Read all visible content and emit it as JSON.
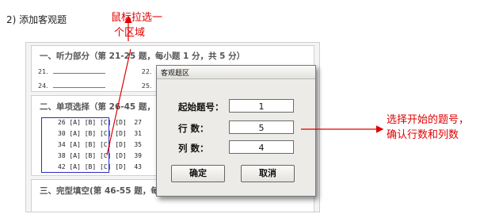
{
  "step_label": "2) 添加客观题",
  "top_note": [
    "鼠标拉选一",
    "个区域"
  ],
  "right_note": [
    "选择开始的题号，",
    "确认行数和列数"
  ],
  "document": {
    "section1_heading": "一、听力部分（第 21-25 题，每小题 1 分，共 5 分）",
    "section1_lines": [
      {
        "num": "21.",
        "next": "22."
      },
      {
        "num": "24.",
        "next": "25."
      }
    ],
    "section2_heading": "二、单项选择（第 26-45 题，",
    "mc_rows": [
      {
        "num": "26",
        "opts": "[A] [B] [C] [D]",
        "next": "27"
      },
      {
        "num": "30",
        "opts": "[A] [B] [C] [D]",
        "next": "31"
      },
      {
        "num": "34",
        "opts": "[A] [B] [C] [D]",
        "next": "35"
      },
      {
        "num": "38",
        "opts": "[A] [B] [C] [D]",
        "next": "39"
      },
      {
        "num": "42",
        "opts": "[A] [B] [C] [D]",
        "next": "43"
      }
    ],
    "section3_heading": "三、完型填空(第 46-55 题，每小"
  },
  "dialog": {
    "title": "客观题区",
    "start_label": "起始题号：",
    "start_value": "1",
    "rows_label": "行   数：",
    "rows_value": "5",
    "cols_label": "列   数：",
    "cols_value": "4",
    "ok_label": "确定",
    "cancel_label": "取消"
  },
  "colors": {
    "annotation": "#e00000",
    "selection_box": "#2c2cc8"
  }
}
